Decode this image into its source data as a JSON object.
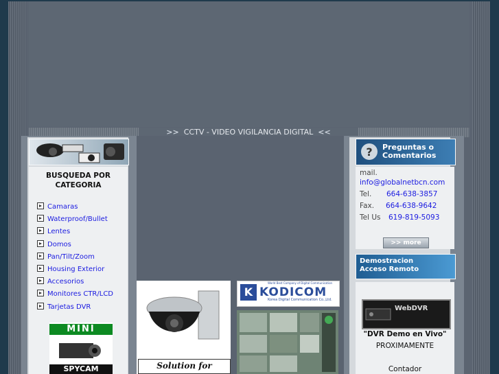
{
  "header": {
    "title": "CCTV - VIDEO VIGILANCIA DIGITAL",
    "left_mark": ">>",
    "right_mark": "<<"
  },
  "left": {
    "heading_line1": "BUSQUEDA POR",
    "heading_line2": "CATEGORIA",
    "categories": [
      "Camaras",
      "Waterproof/Bullet",
      "Lentes",
      "Domos",
      "Pan/Tilt/Zoom",
      "Housing Exterior",
      "Accesorios",
      "Monitores CTR/LCD",
      "Tarjetas DVR"
    ],
    "spycam_top": "MINI",
    "spycam_bottom": "SPYCAM"
  },
  "center": {
    "solution_text": "Solution for",
    "kodicom_name": "KODICOM",
    "kodicom_tag": "Korea Digital Communication Co.,Ltd.",
    "kodicom_top": "World Best Company of Digital Communication"
  },
  "right": {
    "banner_line1": "Preguntas o",
    "banner_line2": "Comentarios",
    "mail_label": "mail.",
    "mail_value": "info@globalnetbcn.com",
    "tel_label": "Tel.",
    "tel_value": "664-638-3857",
    "fax_label": "Fax.",
    "fax_value": "664-638-9642",
    "telus_label": "Tel Us",
    "telus_value": "619-819-5093",
    "more_label": ">> more",
    "demo_line1": "Demostracion",
    "demo_line2": "Acceso Remoto",
    "webdvr_label": "WebDVR",
    "dvr_demo": "\"DVR Demo en Vivo\"",
    "proximamente": "PROXIMAMENTE",
    "contador": "Contador"
  }
}
